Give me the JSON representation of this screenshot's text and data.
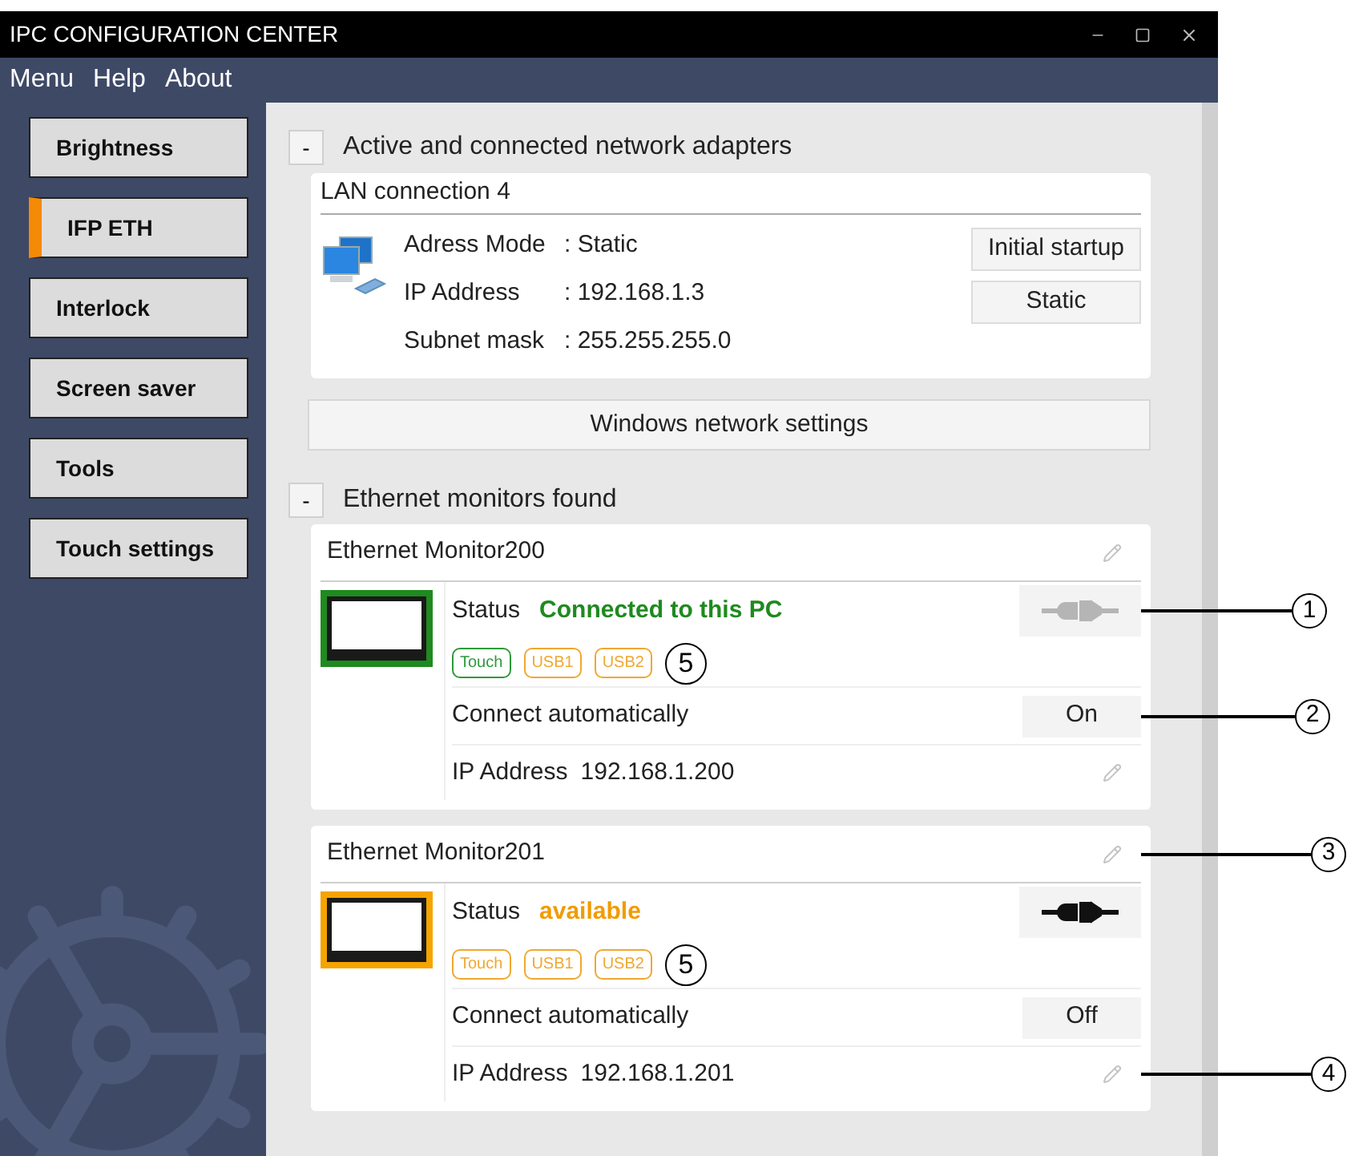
{
  "window": {
    "title": "IPC CONFIGURATION CENTER"
  },
  "menu": [
    "Menu",
    "Help",
    "About"
  ],
  "sidebar": {
    "items": [
      {
        "label": "Brightness",
        "selected": false
      },
      {
        "label": "IFP ETH",
        "selected": true
      },
      {
        "label": "Interlock",
        "selected": false
      },
      {
        "label": "Screen saver",
        "selected": false
      },
      {
        "label": "Tools",
        "selected": false
      },
      {
        "label": "Touch settings",
        "selected": false
      }
    ]
  },
  "adapters": {
    "toggle": "-",
    "title": "Active and connected network adapters",
    "connection": {
      "name": "LAN connection 4",
      "fields": [
        {
          "label": "Adress Mode",
          "value": ": Static"
        },
        {
          "label": "IP Address",
          "value": ": 192.168.1.3"
        },
        {
          "label": "Subnet mask",
          "value": ": 255.255.255.0"
        }
      ],
      "buttons": [
        "Initial startup",
        "Static"
      ]
    },
    "settings_button": "Windows network settings"
  },
  "monitors": {
    "toggle": "-",
    "title": "Ethernet monitors found",
    "items": [
      {
        "name": "Ethernet Monitor200",
        "status_label": "Status",
        "status": "Connected to this PC",
        "connected": true,
        "plug_callout": "1",
        "tags": [
          {
            "label": "Touch",
            "color": "#2e9a3a"
          },
          {
            "label": "USB1",
            "color": "#f0a830"
          },
          {
            "label": "USB2",
            "color": "#f0a830"
          }
        ],
        "tags_callout": "5",
        "auto_label": "Connect automatically",
        "auto_value": "On",
        "auto_callout": "2",
        "ip_label": "IP Address",
        "ip": "192.168.1.200"
      },
      {
        "name": "Ethernet Monitor201",
        "name_callout": "3",
        "status_label": "Status",
        "status": "available",
        "connected": false,
        "tags": [
          {
            "label": "Touch",
            "color": "#f0a830"
          },
          {
            "label": "USB1",
            "color": "#f0a830"
          },
          {
            "label": "USB2",
            "color": "#f0a830"
          }
        ],
        "tags_callout": "5",
        "auto_label": "Connect automatically",
        "auto_value": "Off",
        "ip_label": "IP Address",
        "ip": "192.168.1.201",
        "ip_callout": "4"
      }
    ]
  }
}
